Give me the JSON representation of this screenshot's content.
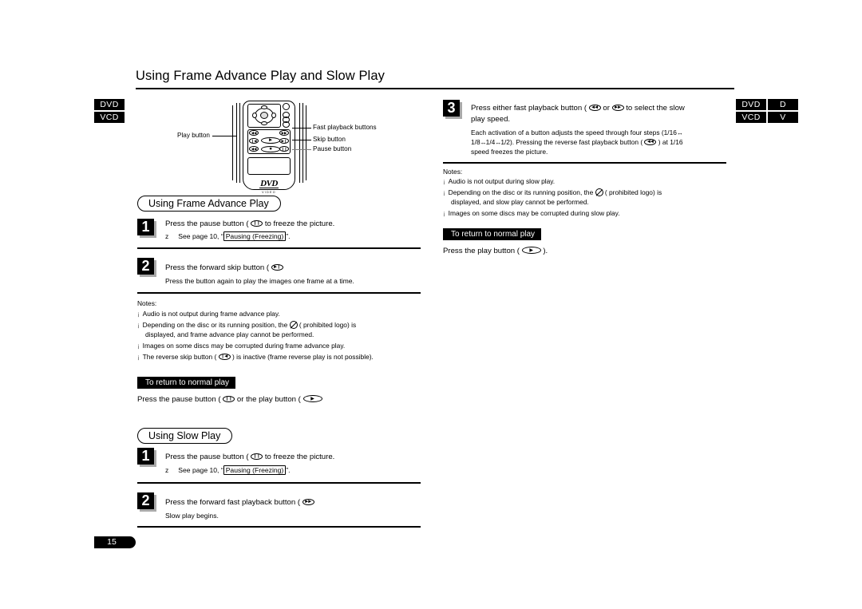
{
  "document": {
    "title": "Using Frame Advance Play and Slow Play",
    "page_number": "15"
  },
  "disc_badges": {
    "left": [
      "DVD",
      "VCD"
    ],
    "right": [
      "DVD",
      "VCD"
    ],
    "right_clipped": [
      "D",
      "V"
    ]
  },
  "remote_diagram": {
    "logo_main": "DVD",
    "logo_sub": "VIDEO",
    "callouts": [
      {
        "label": "Play button",
        "name": "play-button-callout"
      },
      {
        "label": "Fast playback buttons",
        "name": "fast-playback-buttons-callout"
      },
      {
        "label": "Skip button",
        "name": "skip-button-callout"
      },
      {
        "label": "Pause button",
        "name": "pause-button-callout"
      }
    ]
  },
  "frame_advance": {
    "heading": "Using Frame Advance Play",
    "step1": {
      "number": "1",
      "line1_before": "Press the pause button (",
      "line1_after": "to freeze the picture.",
      "sub_bullet": "z",
      "sub_before": "See page 10, “",
      "sub_boxed": "Pausing (Freezing)",
      "sub_after": "”."
    },
    "step2": {
      "number": "2",
      "line1_before": "Press the forward skip button (",
      "line2": "Press the button again to play the images one frame at a time."
    },
    "notes_title": "Notes:",
    "notes": [
      {
        "text": "Audio is not output during frame advance play."
      },
      {
        "prefix": "Depending on the disc or its running position, the",
        "suffix": "( prohibited  logo) is",
        "line2": "displayed, and frame advance play cannot be performed."
      },
      {
        "text": "Images on some discs may be corrupted during frame advance play."
      },
      {
        "prefix": "The reverse skip button (",
        "suffix": ") is inactive (frame reverse play is not possible)."
      }
    ],
    "return_bar": "To return to normal play",
    "return_text_before": "Press the pause button (",
    "return_text_middle": "or the play button (",
    "return_text_after": ""
  },
  "slow_play": {
    "heading": "Using Slow Play",
    "step1": {
      "number": "1",
      "line1_before": "Press the pause button (",
      "line1_after": "to freeze the picture.",
      "sub_bullet": "z",
      "sub_before": "See page 10, “",
      "sub_boxed": "Pausing (Freezing)",
      "sub_after": "”."
    },
    "step2": {
      "number": "2",
      "line1_before": "Press the forward fast playback button (",
      "line2": "Slow play begins."
    },
    "step3": {
      "number": "3",
      "line1_a": "Press either fast playback button (",
      "line1_b": "or",
      "line1_c": "to select the slow",
      "line2": "play speed.",
      "body_1a": "Each activation of a button adjusts the speed through four steps (1/16",
      "body_2a": "1/8",
      "body_2b": "1/4",
      "body_2c": "1/2). Pressing the reverse fast playback button (",
      "body_2d": ") at 1/16",
      "body_3": "speed freezes the picture.",
      "arrow": "↔"
    },
    "notes_title": "Notes:",
    "notes": [
      {
        "text": "Audio is not output during slow play."
      },
      {
        "prefix": "Depending on the disc or its running position, the",
        "suffix": "( prohibited  logo) is",
        "line2": "displayed, and slow play cannot be performed."
      },
      {
        "text": "Images on some discs may be corrupted during slow play."
      }
    ],
    "return_bar": "To return to normal play",
    "return_text_before": "Press the play button (",
    "return_text_after": ")."
  },
  "glyphs": {
    "pause": "❙❙",
    "play": "▶",
    "skip_next": "▶❙",
    "skip_prev": "❙◀",
    "fast_forward": "▶▶",
    "rewind": "◀◀",
    "stop": "■",
    "bullet": "¡"
  }
}
